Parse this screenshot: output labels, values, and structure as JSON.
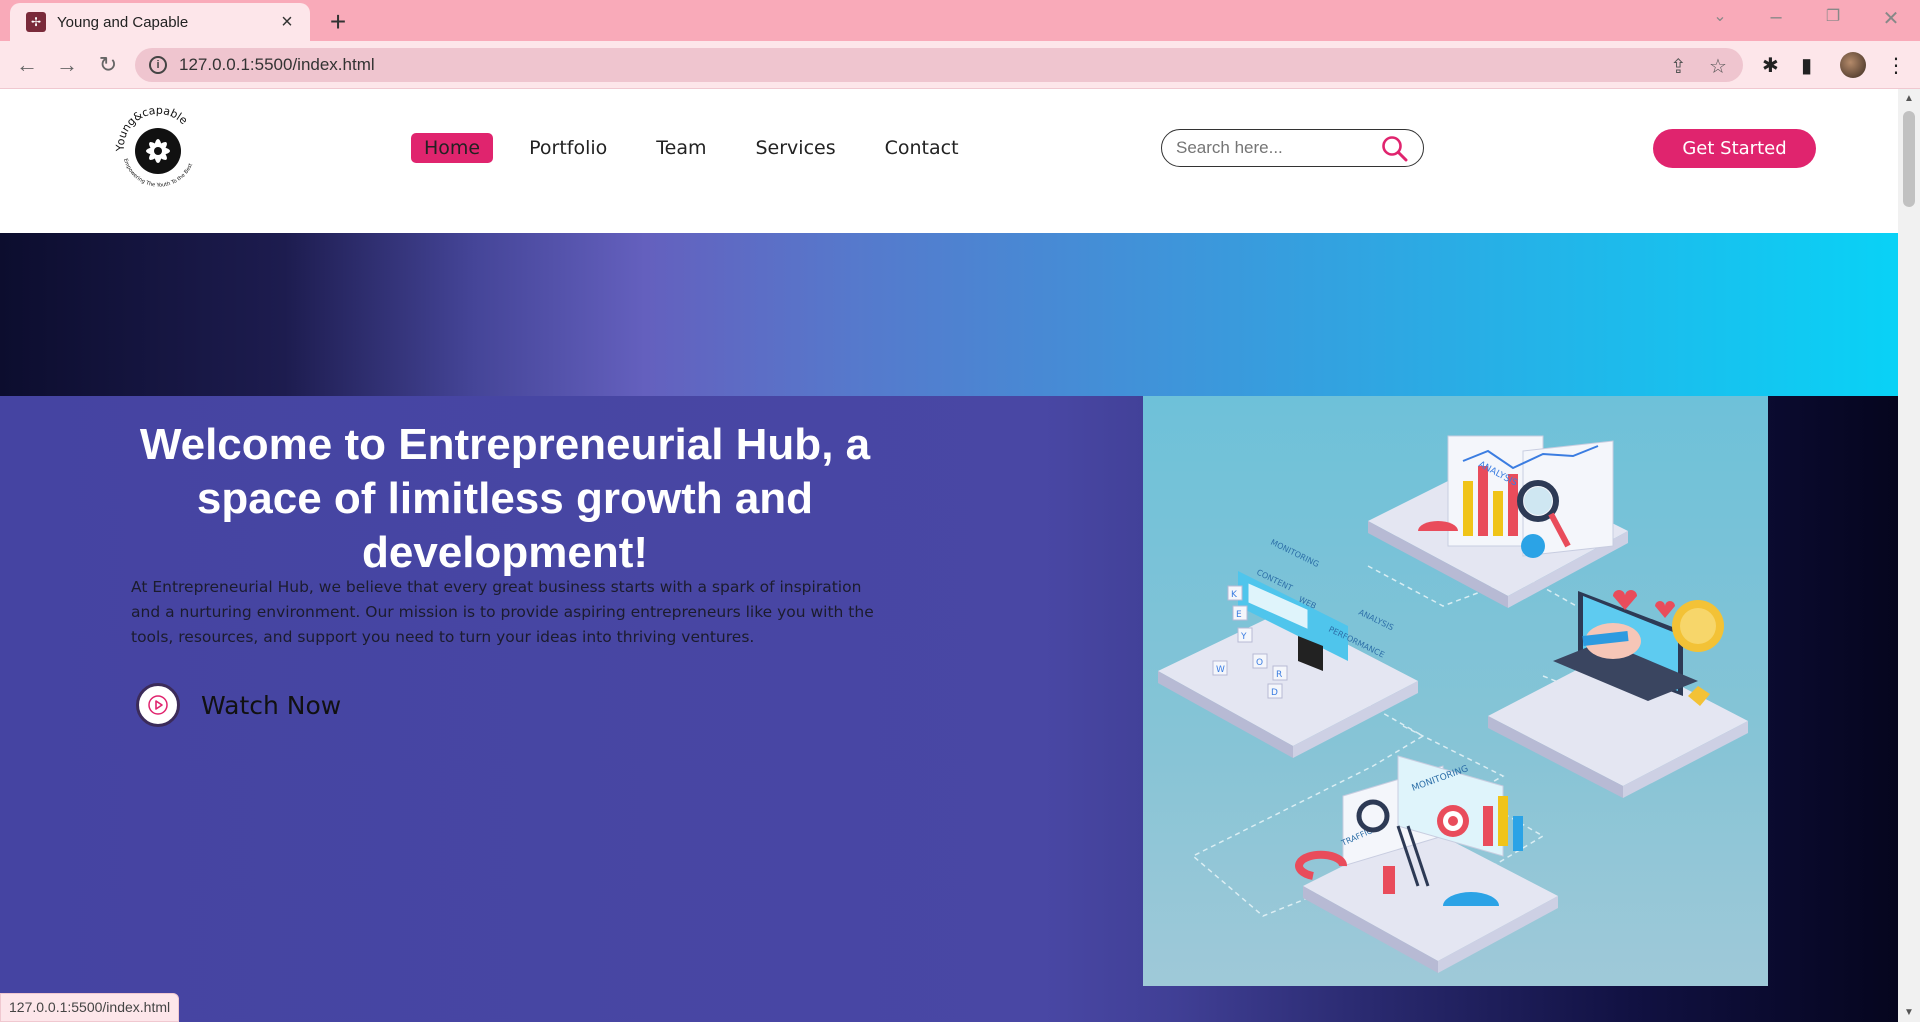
{
  "browser": {
    "tab_title": "Young and Capable",
    "url": "127.0.0.1:5500/index.html",
    "status_url": "127.0.0.1:5500/index.html"
  },
  "site": {
    "logo": {
      "top_text": "Young&capable",
      "bottom_text": "Empowering The Youth To the Best"
    },
    "nav": [
      {
        "label": "Home",
        "active": true
      },
      {
        "label": "Portfolio",
        "active": false
      },
      {
        "label": "Team",
        "active": false
      },
      {
        "label": "Services",
        "active": false
      },
      {
        "label": "Contact",
        "active": false
      }
    ],
    "search": {
      "placeholder": "Search here..."
    },
    "cta_label": "Get Started"
  },
  "hero": {
    "title": "Welcome to Entrepreneurial Hub, a space of limitless growth and development!",
    "description": "At Entrepreneurial Hub, we believe that every great business starts with a spark of inspiration and a nurturing environment. Our mission is to provide aspiring entrepreneurs like you with the tools, resources, and support you need to turn your ideas into thriving ventures.",
    "watch_label": "Watch Now",
    "illustration_labels": [
      "ANALYSIS",
      "MONITORING",
      "CONTENT",
      "WEB",
      "ANALYSIS",
      "PERFORMANCE",
      "MONITORING",
      "TRAFFIC"
    ],
    "keyword_letters": [
      "K",
      "E",
      "Y",
      "W",
      "O",
      "R",
      "D"
    ]
  },
  "colors": {
    "accent": "#e0246e",
    "tabbar": "#f9aab9",
    "hero_bg": "#4947a4",
    "banner_end": "#09d2f6"
  }
}
